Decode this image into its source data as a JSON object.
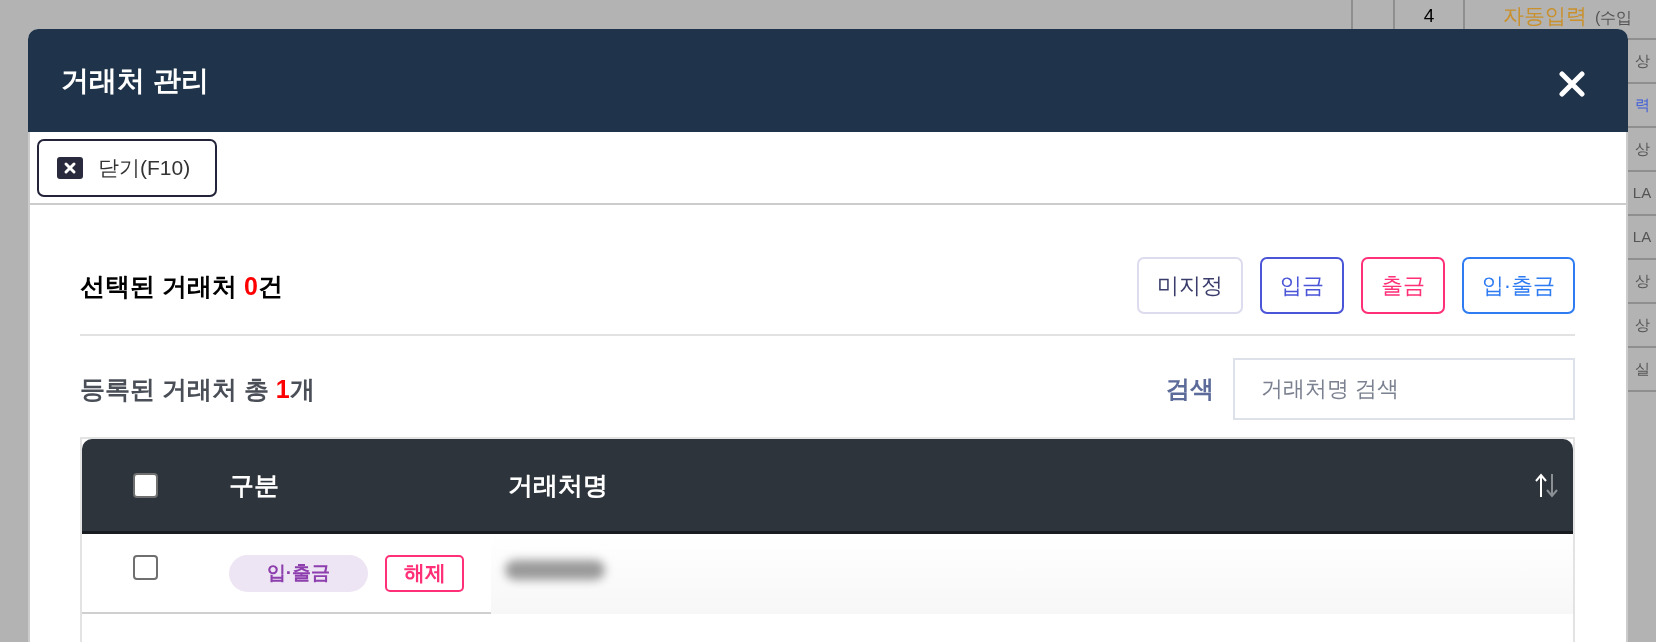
{
  "background": {
    "top_row": {
      "number": "4",
      "source": "자동입력",
      "note": "(수입"
    },
    "side_rows": [
      {
        "text": "상",
        "kind": "plain"
      },
      {
        "text": "력",
        "kind": "link"
      },
      {
        "text": "상",
        "kind": "plain"
      },
      {
        "text": "LA",
        "kind": "plain"
      },
      {
        "text": "LA",
        "kind": "plain"
      },
      {
        "text": "상",
        "kind": "plain"
      },
      {
        "text": "상",
        "kind": "plain"
      },
      {
        "text": "실",
        "kind": "plain"
      }
    ]
  },
  "dialog": {
    "title": "거래처 관리",
    "toolbar": [
      {
        "label": "닫기(F10)"
      }
    ],
    "selection": {
      "text_before": "선택된 거래처 ",
      "count": "0",
      "text_after": "건"
    },
    "filter_buttons": [
      {
        "label": "미지정",
        "kind": "unassigned"
      },
      {
        "label": "입금",
        "kind": "deposit"
      },
      {
        "label": "출금",
        "kind": "withdrawal"
      },
      {
        "label": "입·출금",
        "kind": "both"
      }
    ],
    "registered": {
      "text_before": "등록된 거래처 총 ",
      "count": "1",
      "text_after": "개"
    },
    "search": {
      "label": "검색",
      "placeholder": "거래처명 검색"
    },
    "table": {
      "select_all": {
        "checked": false
      },
      "columns": [
        {
          "label": "구분"
        },
        {
          "label": "거래처명"
        }
      ],
      "rows": [
        {
          "checked": false,
          "type_badge": {
            "label": "입·출금",
            "kind": "both"
          },
          "action": "해제"
        }
      ]
    }
  }
}
